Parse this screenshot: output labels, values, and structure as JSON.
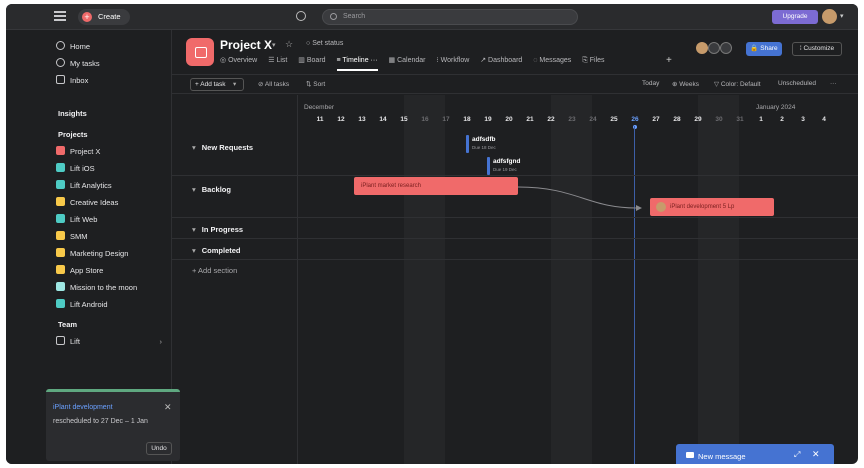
{
  "topbar": {
    "create_label": "Create",
    "search_placeholder": "Search",
    "upgrade_label": "Upgrade"
  },
  "sidebar": {
    "nav": [
      {
        "label": "Home",
        "icon": "home-icon"
      },
      {
        "label": "My tasks",
        "icon": "check-circle-icon"
      },
      {
        "label": "Inbox",
        "icon": "bell-icon"
      }
    ],
    "insights_label": "Insights",
    "projects_label": "Projects",
    "projects": [
      {
        "label": "Project X",
        "color": "#f06a6a"
      },
      {
        "label": "Lift iOS",
        "color": "#4ecbc4"
      },
      {
        "label": "Lift Analytics",
        "color": "#4ecbc4"
      },
      {
        "label": "Creative Ideas",
        "color": "#f8c94a"
      },
      {
        "label": "Lift Web",
        "color": "#4ecbc4"
      },
      {
        "label": "SMM",
        "color": "#f8c94a"
      },
      {
        "label": "Marketing Design",
        "color": "#f8c94a"
      },
      {
        "label": "App Store",
        "color": "#f8c94a"
      },
      {
        "label": "Mission to the moon",
        "color": "#9ee7e3"
      },
      {
        "label": "Lift Android",
        "color": "#4ecbc4"
      }
    ],
    "team_label": "Team",
    "team_item": "Lift"
  },
  "toast": {
    "title": "iPlant development",
    "message": "rescheduled to 27 Dec – 1 Jan",
    "undo_label": "Undo"
  },
  "project": {
    "title": "Project X",
    "set_status": "Set status",
    "tabs": [
      "Overview",
      "List",
      "Board",
      "Timeline",
      "Calendar",
      "Workflow",
      "Dashboard",
      "Messages",
      "Files"
    ],
    "active_tab": "Timeline",
    "share_label": "Share",
    "customize_label": "Customize"
  },
  "toolbar": {
    "add_task": "+ Add task",
    "all_tasks": "All tasks",
    "sort": "Sort",
    "today": "Today",
    "weeks": "Weeks",
    "color": "Color: Default",
    "unscheduled": "Unscheduled",
    "more": "···"
  },
  "timeline": {
    "month_1": "December",
    "month_2": "January 2024",
    "days": [
      "11",
      "12",
      "13",
      "14",
      "15",
      "16",
      "17",
      "18",
      "19",
      "20",
      "21",
      "22",
      "23",
      "24",
      "25",
      "26",
      "27",
      "28",
      "29",
      "30",
      "31",
      "1",
      "2",
      "3",
      "4"
    ],
    "today": "26"
  },
  "sections": {
    "new_requests": "New Requests",
    "backlog": "Backlog",
    "in_progress": "In Progress",
    "completed": "Completed",
    "add_section": "+ Add section"
  },
  "tasks": {
    "m1_title": "adfsdfb",
    "m1_sub": "Due 18 Dec",
    "m2_title": "adfsfgnd",
    "m2_sub": "Due 19 Dec",
    "bar1": "iPlant market research",
    "bar2": "iPlant development 5 Lp"
  },
  "new_message": {
    "label": "New message"
  }
}
